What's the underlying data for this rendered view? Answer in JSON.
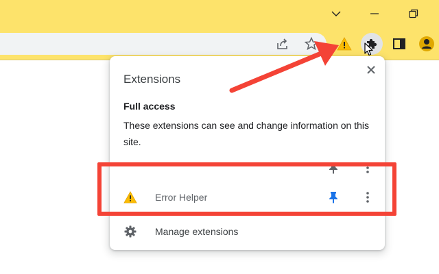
{
  "window": {
    "icons": {
      "chevron": "chevron-down-icon",
      "minimize": "minimize-icon",
      "restore": "restore-icon"
    }
  },
  "toolbar": {
    "icons": [
      "share-icon",
      "bookmark-star-icon",
      "warning-icon",
      "puzzle-extensions-icon",
      "side-panel-icon",
      "avatar-icon"
    ]
  },
  "popup": {
    "title": "Extensions",
    "section_title": "Full access",
    "section_description": "These extensions can see and change information on this site.",
    "extensions": [
      {
        "name": "Error Helper",
        "icon": "warning-icon",
        "pinned": true
      }
    ],
    "manage_label": "Manage extensions"
  },
  "colors": {
    "titlebar": "#fde36b",
    "annotation": "#f44336",
    "pin_active": "#1a73e8",
    "warning": "#fbbc04"
  }
}
